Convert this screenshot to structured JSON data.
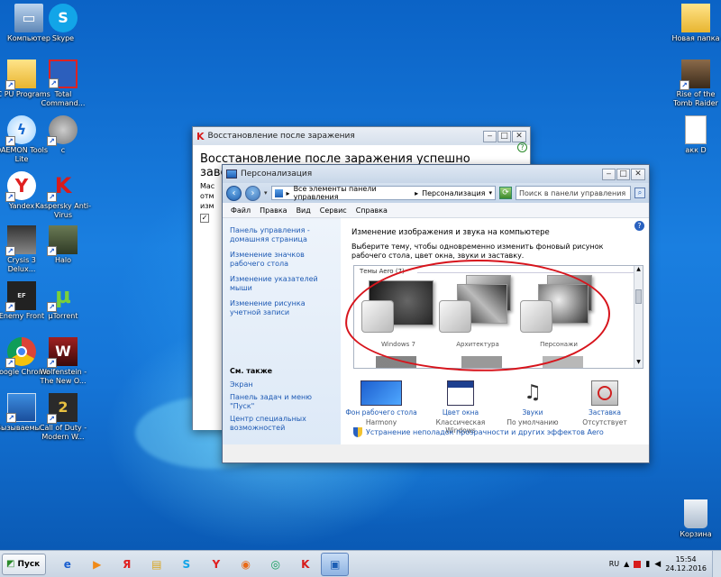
{
  "desktop_icons": [
    {
      "label": "Компьютер",
      "icon": "computer-icon"
    },
    {
      "label": "Skype",
      "icon": "skype-icon"
    },
    {
      "label": "TC PU Programs",
      "icon": "folder-icon"
    },
    {
      "label": "Total Command...",
      "icon": "total-commander-icon"
    },
    {
      "label": "DAEMON Tools Lite",
      "icon": "daemon-tools-icon"
    },
    {
      "label": "c",
      "icon": "c-icon"
    },
    {
      "label": "Yandex",
      "icon": "yandex-icon"
    },
    {
      "label": "Kaspersky Anti-Virus",
      "icon": "kaspersky-icon"
    },
    {
      "label": "Crysis 3 Delux...",
      "icon": "crysis-icon"
    },
    {
      "label": "Halo",
      "icon": "halo-icon"
    },
    {
      "label": "Enemy Front",
      "icon": "enemy-front-icon"
    },
    {
      "label": "µTorrent",
      "icon": "utorrent-icon"
    },
    {
      "label": "Google Chrome",
      "icon": "chrome-icon"
    },
    {
      "label": "Wolfenstein - The New O...",
      "icon": "wolfenstein-icon"
    },
    {
      "label": "Вызываемы...",
      "icon": "shortcut-icon"
    },
    {
      "label": "Call of Duty - Modern W...",
      "icon": "call-of-duty-icon"
    },
    {
      "label": "Новая папка",
      "icon": "folder-icon"
    },
    {
      "label": "Rise of the Tomb Raider",
      "icon": "tomb-raider-icon"
    },
    {
      "label": "акк D",
      "icon": "document-icon"
    },
    {
      "label": "Корзина",
      "icon": "recycle-bin-icon"
    }
  ],
  "bg_window": {
    "title": "Восстановление после заражения",
    "heading": "Восстановление после заражения успешно завершено",
    "frags": [
      "Мас",
      "отм",
      "изм",
      "изм"
    ]
  },
  "window": {
    "title": "Персонализация",
    "address": {
      "crumb1": "Все элементы панели управления",
      "crumb2": "Персонализация",
      "search_placeholder": "Поиск в панели управления"
    },
    "menu": [
      "Файл",
      "Правка",
      "Вид",
      "Сервис",
      "Справка"
    ],
    "left": {
      "home": "Панель управления - домашняя страница",
      "links": [
        "Изменение значков рабочего стола",
        "Изменение указателей мыши",
        "Изменение рисунка учетной записи"
      ],
      "see_also_title": "См. также",
      "see_also": [
        "Экран",
        "Панель задач и меню \"Пуск\"",
        "Центр специальных возможностей"
      ]
    },
    "main": {
      "heading": "Изменение изображения и звука на компьютере",
      "desc": "Выберите тему, чтобы одновременно изменить фоновый рисунок рабочего стола, цвет окна, звуки и заставку.",
      "themes_group": "Темы Aero (7)",
      "themes": [
        "Windows 7",
        "Архитектура",
        "Персонажи"
      ],
      "bottom": [
        {
          "label": "Фон рабочего стола",
          "sub": "Harmony"
        },
        {
          "label": "Цвет окна",
          "sub": "Классическая Windows"
        },
        {
          "label": "Звуки",
          "sub": "По умолчанию"
        },
        {
          "label": "Заставка",
          "sub": "Отсутствует"
        }
      ],
      "troubleshoot": "Устранение неполадок прозрачности и других эффектов Aero"
    }
  },
  "taskbar": {
    "start_label": "Пуск",
    "lang": "RU",
    "time": "15:54",
    "date": "24.12.2016"
  }
}
